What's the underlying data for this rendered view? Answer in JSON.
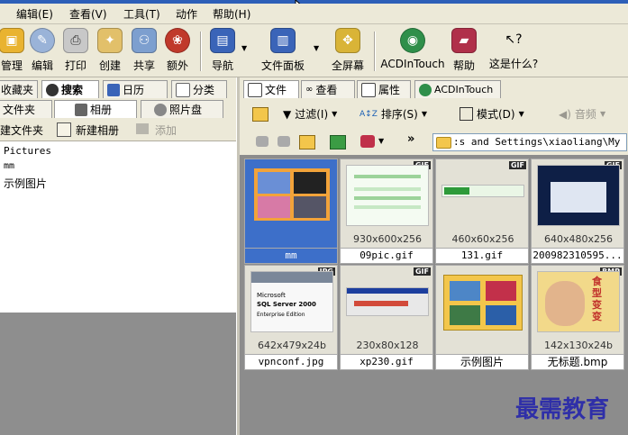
{
  "menu": [
    "编辑(E)",
    "查看(V)",
    "工具(T)",
    "动作",
    "帮助(H)"
  ],
  "toolbar": {
    "manage": "管理",
    "edit": "编辑",
    "print": "打印",
    "create": "创建",
    "share": "共享",
    "extra": "额外",
    "navigate": "导航",
    "filepanel": "文件面板",
    "fullscreen": "全屏幕",
    "acdintouch": "ACDInTouch",
    "help": "帮助",
    "whatsthis": "这是什么?"
  },
  "left_tabs": {
    "favorites": "收藏夹",
    "search": "搜索",
    "calendar": "日历",
    "category": "分类"
  },
  "left_subtabs": {
    "folder": "文件夹",
    "album": "相册",
    "photodisc": "照片盘"
  },
  "left_actions": {
    "new_folder": "建文件夹",
    "new_album": "新建相册",
    "add": "添加"
  },
  "tree": {
    "item1": "Pictures",
    "item2": "mm",
    "item3": "示例图片"
  },
  "right_tabs": {
    "file": "文件",
    "view": "查看",
    "properties": "属性",
    "acdintouch": "ACDInTouch"
  },
  "right_tool1": {
    "filter": "过滤(I)",
    "sort": "排序(S)",
    "mode": "模式(D)",
    "audio": "音频"
  },
  "address": ":s and Settings\\xiaoliang\\My D",
  "thumbs": [
    {
      "dim": "",
      "name": "mm",
      "badge": ""
    },
    {
      "dim": "930x600x256",
      "name": "09pic.gif",
      "badge": "GIF"
    },
    {
      "dim": "460x60x256",
      "name": "131.gif",
      "badge": "GIF"
    },
    {
      "dim": "640x480x256",
      "name": "200982310595...",
      "badge": "GIF"
    },
    {
      "dim": "642x479x24b",
      "name": "vpnconf.jpg",
      "badge": "JPG"
    },
    {
      "dim": "230x80x128",
      "name": "xp230.gif",
      "badge": "GIF"
    },
    {
      "dim": "",
      "name": "示例图片",
      "badge": ""
    },
    {
      "dim": "142x130x24b",
      "name": "无标题.bmp",
      "badge": "BMP"
    }
  ],
  "thumb_art": {
    "sql_line1": "Microsoft",
    "sql_line2": "SQL Server 2000",
    "sql_line3": "Enterprise Edition",
    "bmp_caption": "食型变变"
  },
  "watermark": "最需教育",
  "colors": {
    "selection": "#3d6fc9",
    "titlebar": "#2d5fb8",
    "watermark": "#2f2fa8"
  }
}
